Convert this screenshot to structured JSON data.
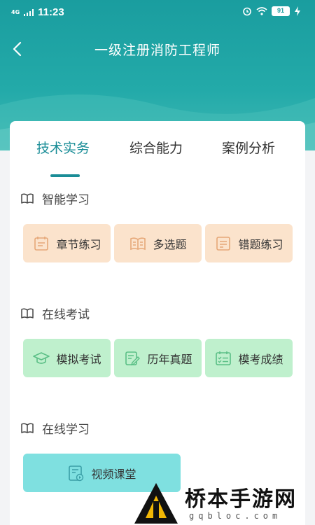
{
  "status_bar": {
    "network": "4G",
    "time": "11:23",
    "battery": "91"
  },
  "header": {
    "title": "一级注册消防工程师"
  },
  "tabs": [
    {
      "label": "技术实务",
      "active": true
    },
    {
      "label": "综合能力",
      "active": false
    },
    {
      "label": "案例分析",
      "active": false
    }
  ],
  "sections": {
    "smart": {
      "title": "智能学习",
      "buttons": [
        "章节练习",
        "多选题",
        "错题练习"
      ]
    },
    "exam": {
      "title": "在线考试",
      "buttons": [
        "模拟考试",
        "历年真题",
        "模考成绩"
      ]
    },
    "study": {
      "title": "在线学习",
      "buttons": [
        "视频课堂"
      ]
    }
  },
  "watermark": {
    "name": "桥本手游网",
    "url": "gqbloc.com"
  },
  "colors": {
    "header": "#1a9d9f",
    "accent": "#1a8d97",
    "orange_button": "#fbe3cc",
    "green_button": "#bff0cd",
    "cyan_button": "#7fe0e0"
  }
}
